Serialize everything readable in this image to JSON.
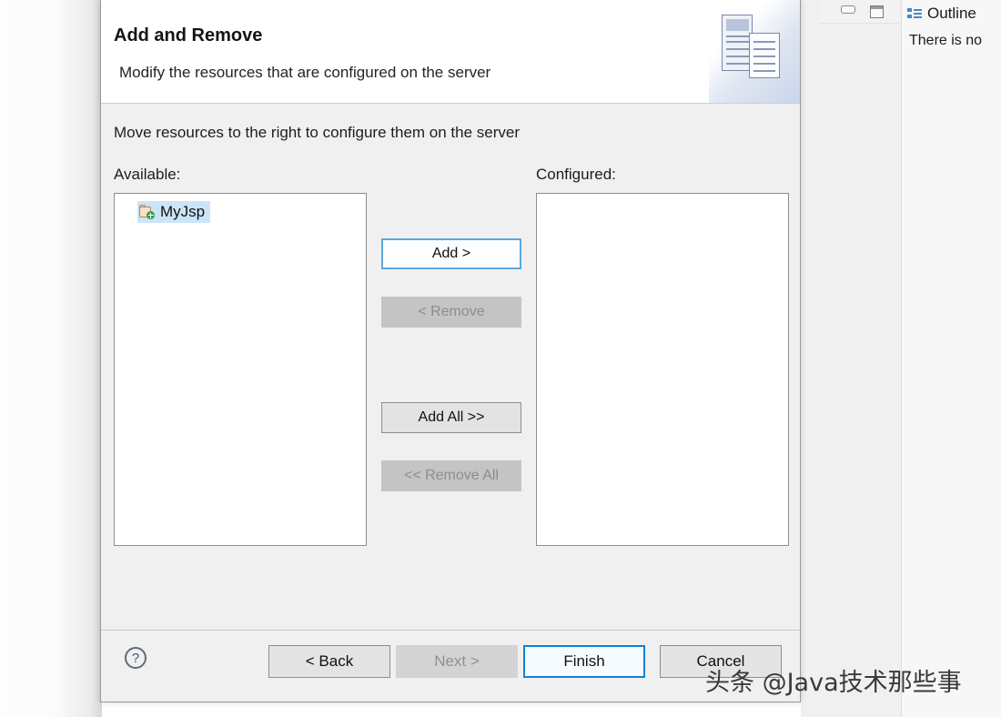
{
  "ide": {
    "outline": {
      "tab_label": "Outline",
      "icon": "outline-tree-icon",
      "body_text": "There is no",
      "minimize_icon": "minimize-icon",
      "maximize_icon": "maximize-icon"
    }
  },
  "dialog": {
    "title": "Add and Remove",
    "subtitle": "Modify the resources that are configured on the server",
    "banner_icon": "server-documents-banner-icon",
    "hint": "Move resources to the right to configure them on the server",
    "available_label": "Available:",
    "configured_label": "Configured:",
    "available_items": [
      {
        "label": "MyJsp",
        "icon": "project-module-add-icon",
        "selected": true
      }
    ],
    "configured_items": [],
    "transfer_buttons": [
      {
        "label": "Add >",
        "state": "focused"
      },
      {
        "label": "< Remove",
        "state": "disabled"
      },
      {
        "label": "Add All >>",
        "state": "enabled"
      },
      {
        "label": "<< Remove All",
        "state": "disabled"
      }
    ],
    "footer": {
      "help_icon": "help-question-icon",
      "help_glyph": "?",
      "back_label": "< Back",
      "next_label": "Next >",
      "finish_label": "Finish",
      "cancel_label": "Cancel"
    }
  },
  "watermark": "头条 @Java技术那些事",
  "colors": {
    "focus_blue": "#0a84d8",
    "selection_blue": "#cce4f7",
    "dialog_bg": "#f0f0f0",
    "disabled_gray": "#c4c4c4"
  }
}
